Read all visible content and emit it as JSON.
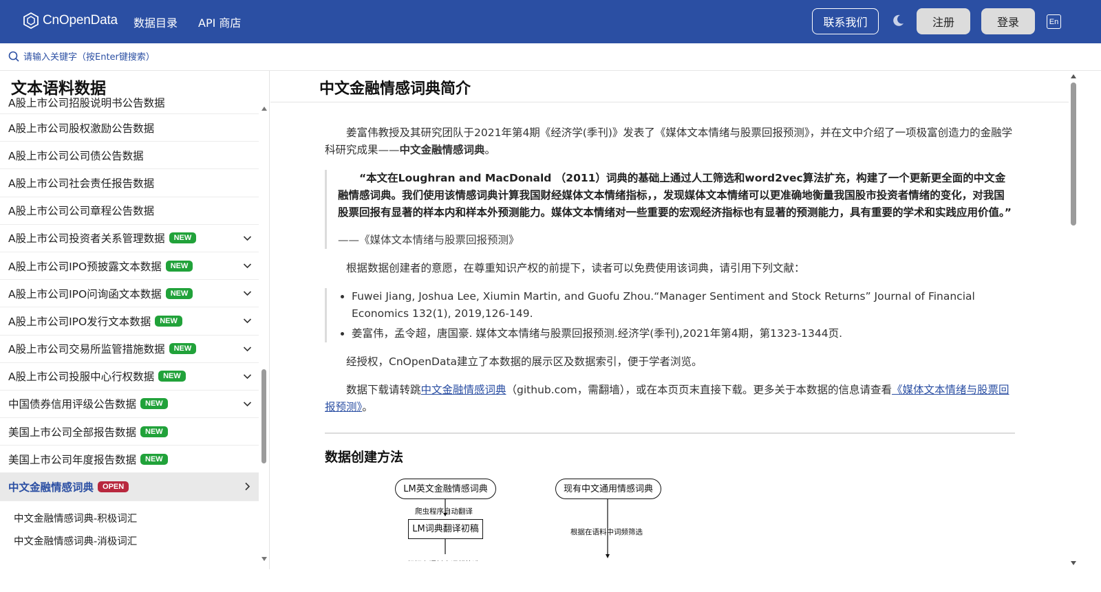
{
  "header": {
    "logo_text": "CnOpenData",
    "nav": [
      "数据目录",
      "API 商店"
    ],
    "contact_label": "联系我们",
    "register_label": "注册",
    "login_label": "登录",
    "lang_label": "En"
  },
  "search": {
    "placeholder": "请输入关键字（按Enter键搜索）"
  },
  "sidebar": {
    "title": "文本语料数据",
    "partial_item": "A股上市公司招股说明书公告数据",
    "items": [
      {
        "label": "A股上市公司股权激励公告数据",
        "badge": "",
        "chevron": ""
      },
      {
        "label": "A股上市公司公司债公告数据",
        "badge": "",
        "chevron": ""
      },
      {
        "label": "A股上市公司社会责任报告数据",
        "badge": "",
        "chevron": ""
      },
      {
        "label": "A股上市公司公司章程公告数据",
        "badge": "",
        "chevron": ""
      },
      {
        "label": "A股上市公司投资者关系管理数据",
        "badge": "NEW",
        "chevron": "down"
      },
      {
        "label": "A股上市公司IPO预披露文本数据",
        "badge": "NEW",
        "chevron": "down"
      },
      {
        "label": "A股上市公司IPO问询函文本数据",
        "badge": "NEW",
        "chevron": "down"
      },
      {
        "label": "A股上市公司IPO发行文本数据",
        "badge": "NEW",
        "chevron": "down"
      },
      {
        "label": "A股上市公司交易所监管措施数据",
        "badge": "NEW",
        "chevron": "down"
      },
      {
        "label": "A股上市公司投服中心行权数据",
        "badge": "NEW",
        "chevron": "down"
      },
      {
        "label": "中国债券信用评级公告数据",
        "badge": "NEW",
        "chevron": "down"
      },
      {
        "label": "美国上市公司全部报告数据",
        "badge": "NEW",
        "chevron": ""
      },
      {
        "label": "美国上市公司年度报告数据",
        "badge": "NEW",
        "chevron": ""
      }
    ],
    "active_item": {
      "label": "中文金融情感词典",
      "badge": "OPEN"
    },
    "subitems": [
      "中文金融情感词典-积极词汇",
      "中文金融情感词典-消极词汇"
    ]
  },
  "main": {
    "title": "中文金融情感词典简介",
    "intro_1": "姜富伟教授及其研究团队于2021年第4期《经济学(季刊)》发表了《媒体文本情绪与股票回报预测》，并在文中介绍了一项极富创造力的金融学科研究成果——",
    "intro_1_bold": "中文金融情感词典",
    "intro_1_end": "。",
    "quote": "“本文在Loughran and MacDonald （2011）词典的基础上通过人工筛选和word2vec算法扩充，构建了一个更新更全面的中文金融情感词典。我们使用该情感词典计算我国财经媒体文本情绪指标，，发现媒体文本情绪可以更准确地衡量我国股市投资者情绪的变化，对我国股票回报有显著的样本内和样本外预测能力。媒体文本情绪对一些重要的宏观经济指标也有显著的预测能力，具有重要的学术和实践应用价值。”",
    "quote_source": "——《媒体文本情绪与股票回报预测》",
    "cite_intro": "根据数据创建者的意愿，在尊重知识产权的前提下，读者可以免费使用该词典，请引用下列文献：",
    "references": [
      "Fuwei Jiang, Joshua Lee, Xiumin Martin, and Guofu Zhou.“Manager Sentiment and Stock Returns” Journal of Financial Economics 132(1), 2019,126-149.",
      "姜富伟，孟令超，唐国豪. 媒体文本情绪与股票回报预测.经济学(季刊),2021年第4期，第1323-1344页."
    ],
    "authorized": "经授权，CnOpenData建立了本数据的展示区及数据索引，便于学者浏览。",
    "download_pre": "数据下载请转跳",
    "download_link": "中文金融情感词典",
    "download_mid": "（github.com，需翻墙），或在本页页末直接下载。更多关于本数据的信息请查看",
    "download_link2": "《媒体文本情绪与股票回报预测》",
    "download_end": "。",
    "section_title": "数据创建方法",
    "diagram": {
      "node_lm": "LM英文金融情感词典",
      "node_cn": "现有中文通用情感词典",
      "label_translate": "爬虫程序自动翻译",
      "node_draft": "LM词典翻译初稿",
      "label_filter": "根据在语料中词频筛选",
      "label_bottom_cut": "根据在语料中词频筛选"
    }
  }
}
